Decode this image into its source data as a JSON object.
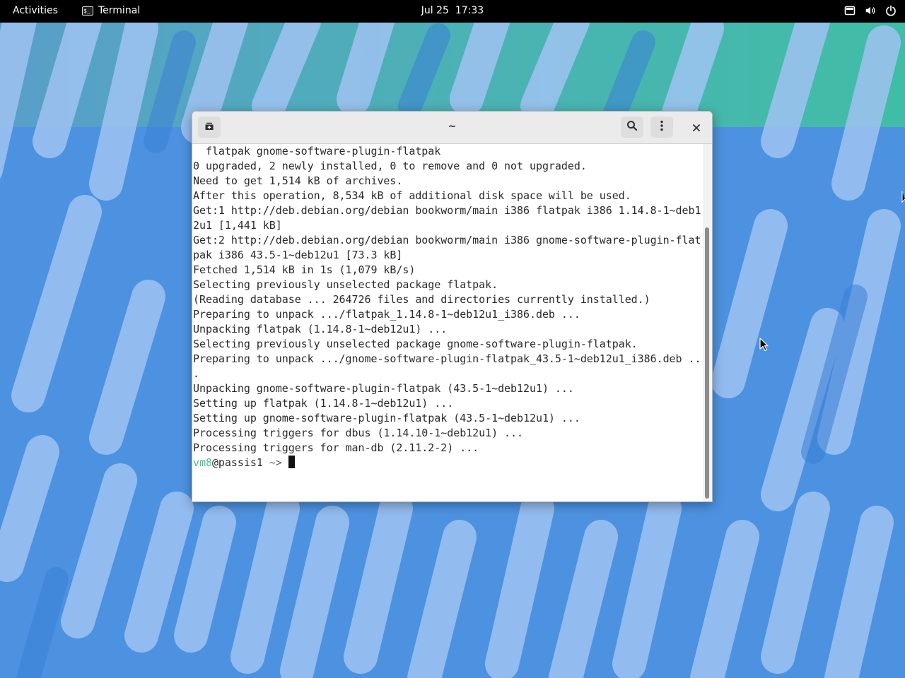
{
  "topbar": {
    "activities": "Activities",
    "app_name": "Terminal",
    "app_icon_glyph": "$_",
    "clock": "Jul 25  17:33",
    "tray_icons": [
      "screen-icon",
      "volume-icon",
      "power-icon"
    ]
  },
  "window": {
    "title": "~",
    "buttons": {
      "new_tab": "new-tab-icon",
      "search": "search-icon",
      "menu": "kebab-menu-icon",
      "close": "close-icon"
    }
  },
  "terminal": {
    "lines": [
      "  flatpak gnome-software-plugin-flatpak",
      "0 upgraded, 2 newly installed, 0 to remove and 0 not upgraded.",
      "Need to get 1,514 kB of archives.",
      "After this operation, 8,534 kB of additional disk space will be used.",
      "Get:1 http://deb.debian.org/debian bookworm/main i386 flatpak i386 1.14.8-1~deb1",
      "2u1 [1,441 kB]",
      "Get:2 http://deb.debian.org/debian bookworm/main i386 gnome-software-plugin-flat",
      "pak i386 43.5-1~deb12u1 [73.3 kB]",
      "Fetched 1,514 kB in 1s (1,079 kB/s)",
      "Selecting previously unselected package flatpak.",
      "(Reading database ... 264726 files and directories currently installed.)",
      "Preparing to unpack .../flatpak_1.14.8-1~deb12u1_i386.deb ...",
      "Unpacking flatpak (1.14.8-1~deb12u1) ...",
      "Selecting previously unselected package gnome-software-plugin-flatpak.",
      "Preparing to unpack .../gnome-software-plugin-flatpak_43.5-1~deb12u1_i386.deb ..",
      ".",
      "Unpacking gnome-software-plugin-flatpak (43.5-1~deb12u1) ...",
      "Setting up flatpak (1.14.8-1~deb12u1) ...",
      "Setting up gnome-software-plugin-flatpak (43.5-1~deb12u1) ...",
      "Processing triggers for dbus (1.14.10-1~deb12u1) ...",
      "Processing triggers for man-db (2.11.2-2) ..."
    ],
    "prompt": {
      "user": "vm8",
      "host": "@passis1",
      "path": " ~> "
    }
  },
  "colors": {
    "prompt_user": "#4fbf8c",
    "topbar": "#000000",
    "wallpaper_base": "#4a8fe0"
  }
}
